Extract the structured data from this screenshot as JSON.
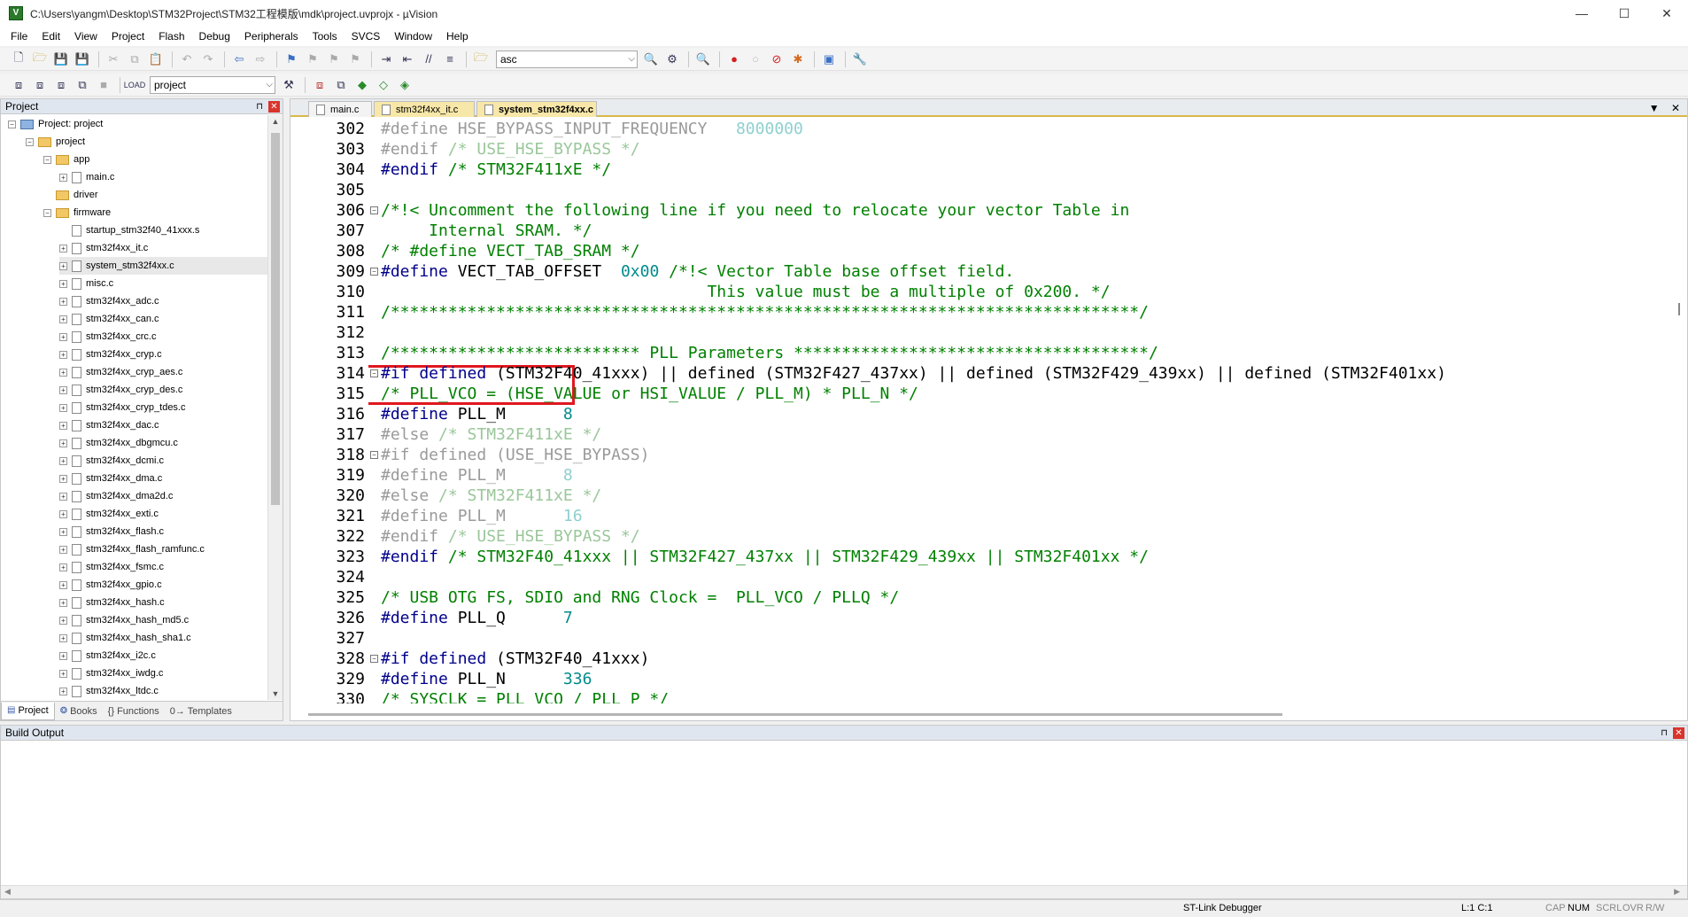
{
  "window": {
    "title": "C:\\Users\\yangm\\Desktop\\STM32Project\\STM32工程模版\\mdk\\project.uvprojx - µVision",
    "minimize": "—",
    "maximize": "☐",
    "close": "✕",
    "app_icon": "V"
  },
  "menu": [
    "File",
    "Edit",
    "View",
    "Project",
    "Flash",
    "Debug",
    "Peripherals",
    "Tools",
    "SVCS",
    "Window",
    "Help"
  ],
  "toolbar": {
    "find_value": "asc",
    "target_value": "project"
  },
  "project_panel": {
    "title": "Project",
    "tree": [
      {
        "label": "Project: project",
        "icon": "project-root-icon"
      },
      {
        "label": "project",
        "icon": "folder-icon"
      },
      {
        "label": "app",
        "icon": "folder-icon"
      },
      {
        "label": "main.c",
        "icon": "file-icon"
      },
      {
        "label": "driver",
        "icon": "folder-icon"
      },
      {
        "label": "firmware",
        "icon": "folder-icon"
      },
      {
        "label": "startup_stm32f40_41xxx.s",
        "icon": "file-icon"
      },
      {
        "label": "stm32f4xx_it.c",
        "icon": "file-icon"
      },
      {
        "label": "system_stm32f4xx.c",
        "icon": "file-icon"
      },
      {
        "label": "misc.c",
        "icon": "file-icon"
      },
      {
        "label": "stm32f4xx_adc.c",
        "icon": "file-icon"
      },
      {
        "label": "stm32f4xx_can.c",
        "icon": "file-icon"
      },
      {
        "label": "stm32f4xx_crc.c",
        "icon": "file-icon"
      },
      {
        "label": "stm32f4xx_cryp.c",
        "icon": "file-icon"
      },
      {
        "label": "stm32f4xx_cryp_aes.c",
        "icon": "file-icon"
      },
      {
        "label": "stm32f4xx_cryp_des.c",
        "icon": "file-icon"
      },
      {
        "label": "stm32f4xx_cryp_tdes.c",
        "icon": "file-icon"
      },
      {
        "label": "stm32f4xx_dac.c",
        "icon": "file-icon"
      },
      {
        "label": "stm32f4xx_dbgmcu.c",
        "icon": "file-icon"
      },
      {
        "label": "stm32f4xx_dcmi.c",
        "icon": "file-icon"
      },
      {
        "label": "stm32f4xx_dma.c",
        "icon": "file-icon"
      },
      {
        "label": "stm32f4xx_dma2d.c",
        "icon": "file-icon"
      },
      {
        "label": "stm32f4xx_exti.c",
        "icon": "file-icon"
      },
      {
        "label": "stm32f4xx_flash.c",
        "icon": "file-icon"
      },
      {
        "label": "stm32f4xx_flash_ramfunc.c",
        "icon": "file-icon"
      },
      {
        "label": "stm32f4xx_fsmc.c",
        "icon": "file-icon"
      },
      {
        "label": "stm32f4xx_gpio.c",
        "icon": "file-icon"
      },
      {
        "label": "stm32f4xx_hash.c",
        "icon": "file-icon"
      },
      {
        "label": "stm32f4xx_hash_md5.c",
        "icon": "file-icon"
      },
      {
        "label": "stm32f4xx_hash_sha1.c",
        "icon": "file-icon"
      },
      {
        "label": "stm32f4xx_i2c.c",
        "icon": "file-icon"
      },
      {
        "label": "stm32f4xx_iwdg.c",
        "icon": "file-icon"
      },
      {
        "label": "stm32f4xx_ltdc.c",
        "icon": "file-icon"
      }
    ],
    "tabs": [
      {
        "label": "Project",
        "icon": "project-tab-icon"
      },
      {
        "label": "Books",
        "icon": "books-icon"
      },
      {
        "label": "{} Functions",
        "icon": "functions-icon"
      },
      {
        "label": "0→ Templates",
        "icon": "templates-icon"
      }
    ]
  },
  "editor": {
    "tabs": [
      {
        "label": "main.c"
      },
      {
        "label": "stm32f4xx_it.c"
      },
      {
        "label": "system_stm32f4xx.c",
        "active": true
      }
    ],
    "lines": [
      {
        "n": "302",
        "segs": [
          {
            "t": "#define HSE_BYPASS_INPUT_FREQUENCY   ",
            "c": "gr"
          },
          {
            "t": "8000000",
            "c": "gn"
          }
        ]
      },
      {
        "n": "303",
        "segs": [
          {
            "t": "#endif ",
            "c": "gr"
          },
          {
            "t": "/* USE_HSE_BYPASS */",
            "c": "gc"
          }
        ]
      },
      {
        "n": "304",
        "segs": [
          {
            "t": "#endif ",
            "c": "kw"
          },
          {
            "t": "/* STM32F411xE */",
            "c": "cm"
          }
        ]
      },
      {
        "n": "305",
        "segs": []
      },
      {
        "n": "306",
        "fold": true,
        "segs": [
          {
            "t": "/*!< Uncomment the following line if you need to relocate your vector Table in",
            "c": "cm"
          }
        ]
      },
      {
        "n": "307",
        "segs": [
          {
            "t": "     Internal SRAM. */",
            "c": "cm"
          }
        ]
      },
      {
        "n": "308",
        "segs": [
          {
            "t": "/* #define VECT_TAB_SRAM */",
            "c": "cm"
          }
        ]
      },
      {
        "n": "309",
        "fold": true,
        "segs": [
          {
            "t": "#define ",
            "c": "kw"
          },
          {
            "t": "VECT_TAB_OFFSET  ",
            "c": ""
          },
          {
            "t": "0x00",
            "c": "nm"
          },
          {
            "t": " /*!< Vector Table base offset field.",
            "c": "cm"
          }
        ]
      },
      {
        "n": "310",
        "segs": [
          {
            "t": "                                  This value must be a multiple of 0x200. */",
            "c": "cm"
          }
        ]
      },
      {
        "n": "311",
        "segs": [
          {
            "t": "/******************************************************************************/",
            "c": "cm"
          }
        ]
      },
      {
        "n": "312",
        "segs": []
      },
      {
        "n": "313",
        "segs": [
          {
            "t": "/************************** PLL Parameters *************************************/",
            "c": "cm"
          }
        ]
      },
      {
        "n": "314",
        "fold": true,
        "segs": [
          {
            "t": "#if defined ",
            "c": "kw"
          },
          {
            "t": "(STM32F40_41xxx) || defined (STM32F427_437xx) || defined (STM32F429_439xx) || defined (STM32F401xx)",
            "c": ""
          }
        ]
      },
      {
        "n": "315",
        "segs": [
          {
            "t": "/* PLL_VCO = (HSE_VALUE or HSI_VALUE / PLL_M) * PLL_N */",
            "c": "cm"
          }
        ]
      },
      {
        "n": "316",
        "segs": [
          {
            "t": "#define ",
            "c": "kw"
          },
          {
            "t": "PLL_M      ",
            "c": ""
          },
          {
            "t": "8",
            "c": "nm"
          }
        ]
      },
      {
        "n": "317",
        "segs": [
          {
            "t": "#else ",
            "c": "gr"
          },
          {
            "t": "/* STM32F411xE */",
            "c": "gc"
          }
        ]
      },
      {
        "n": "318",
        "fold": true,
        "segs": [
          {
            "t": "#if defined (USE_HSE_BYPASS)",
            "c": "gr"
          }
        ]
      },
      {
        "n": "319",
        "segs": [
          {
            "t": "#define PLL_M      ",
            "c": "gr"
          },
          {
            "t": "8",
            "c": "gn"
          }
        ]
      },
      {
        "n": "320",
        "segs": [
          {
            "t": "#else ",
            "c": "gr"
          },
          {
            "t": "/* STM32F411xE */",
            "c": "gc"
          }
        ]
      },
      {
        "n": "321",
        "segs": [
          {
            "t": "#define PLL_M      ",
            "c": "gr"
          },
          {
            "t": "16",
            "c": "gn"
          }
        ]
      },
      {
        "n": "322",
        "segs": [
          {
            "t": "#endif ",
            "c": "gr"
          },
          {
            "t": "/* USE_HSE_BYPASS */",
            "c": "gc"
          }
        ]
      },
      {
        "n": "323",
        "segs": [
          {
            "t": "#endif ",
            "c": "kw"
          },
          {
            "t": "/* STM32F40_41xxx || STM32F427_437xx || STM32F429_439xx || STM32F401xx */",
            "c": "cm"
          }
        ]
      },
      {
        "n": "324",
        "segs": []
      },
      {
        "n": "325",
        "segs": [
          {
            "t": "/* USB OTG FS, SDIO and RNG Clock =  PLL_VCO / PLLQ */",
            "c": "cm"
          }
        ]
      },
      {
        "n": "326",
        "segs": [
          {
            "t": "#define ",
            "c": "kw"
          },
          {
            "t": "PLL_Q      ",
            "c": ""
          },
          {
            "t": "7",
            "c": "nm"
          }
        ]
      },
      {
        "n": "327",
        "segs": []
      },
      {
        "n": "328",
        "fold": true,
        "segs": [
          {
            "t": "#if defined ",
            "c": "kw"
          },
          {
            "t": "(STM32F40_41xxx)",
            "c": ""
          }
        ]
      },
      {
        "n": "329",
        "segs": [
          {
            "t": "#define ",
            "c": "kw"
          },
          {
            "t": "PLL_N      ",
            "c": ""
          },
          {
            "t": "336",
            "c": "nm"
          }
        ]
      },
      {
        "n": "330",
        "segs": [
          {
            "t": "/* SYSCLK = PLL_VCO / PLL_P */",
            "c": "cm"
          }
        ]
      }
    ]
  },
  "build_output": {
    "title": "Build Output"
  },
  "status": {
    "debugger": "ST-Link Debugger",
    "position": "L:1 C:1",
    "cap": "CAP",
    "num": "NUM",
    "scrl": "SCRL",
    "ovr": "OVR",
    "rw": "R/W"
  }
}
